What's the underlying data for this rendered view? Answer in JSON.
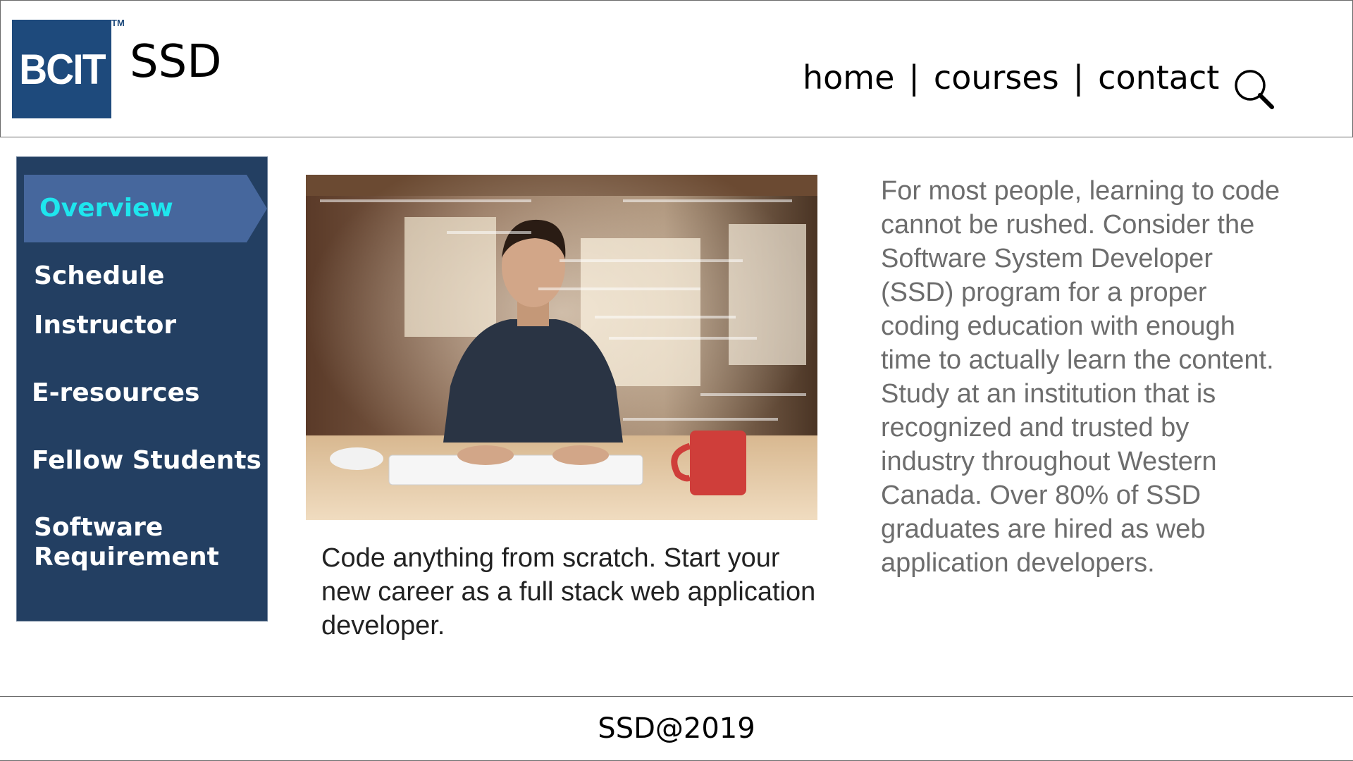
{
  "header": {
    "logo_text": "BCIT",
    "logo_tm": "TM",
    "title": "SSD",
    "nav": [
      {
        "label": "home"
      },
      {
        "label": "courses"
      },
      {
        "label": "contact"
      }
    ],
    "separator": "|",
    "search_icon": "search-icon"
  },
  "sidebar": {
    "items": [
      {
        "label": "Overview",
        "active": true
      },
      {
        "label": "Schedule"
      },
      {
        "label": "Instructor"
      },
      {
        "label": "E-resources"
      },
      {
        "label": "Fellow Students"
      },
      {
        "label_line1": "Software",
        "label_line2": "Requirement"
      }
    ]
  },
  "main": {
    "caption": "Code anything from scratch. Start your new career as a full stack web application developer.",
    "paragraph": "For most people, learning to code cannot be rushed. Consider the Software System Developer (SSD) program for a proper coding education with enough time to actually learn the content. Study at an institution that is recognized and trusted by industry throughout Western Canada. Over 80% of SSD graduates are hired as web application developers."
  },
  "footer": {
    "text": "SSD@2019"
  },
  "colors": {
    "logo_bg": "#1e4a7c",
    "sidebar_bg": "#233f62",
    "active_bg": "#46679d",
    "active_text": "#1ee6ee",
    "paragraph_text": "#6d6d6d"
  }
}
